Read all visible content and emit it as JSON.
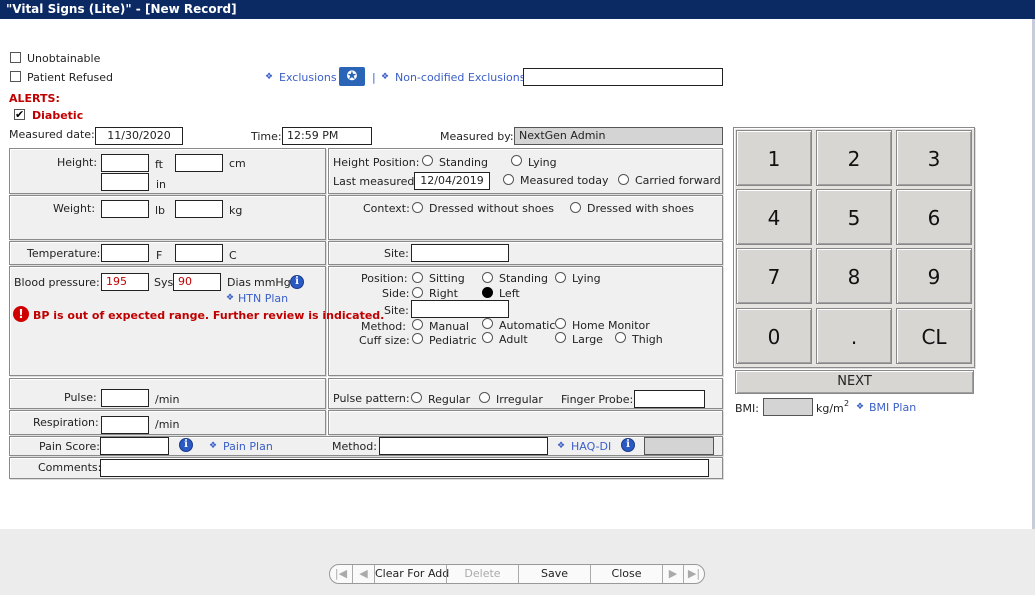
{
  "window": {
    "title": "\"Vital Signs (Lite)\" - [New Record]"
  },
  "checks": {
    "unobtainable": "Unobtainable",
    "patient_refused": "Patient Refused"
  },
  "exclusions": {
    "label": "Exclusions",
    "separator": "|",
    "noncodified_label": "Non-codified Exclusions",
    "noncodified_value": ""
  },
  "alerts": {
    "heading": "ALERTS:",
    "diabetic": "Diabetic",
    "check_mark": "✔"
  },
  "measured": {
    "date_label": "Measured date:",
    "date_value": "11/30/2020",
    "time_label": "Time:",
    "time_value": "12:59 PM",
    "by_label": "Measured by:",
    "by_value": "NextGen Admin"
  },
  "height": {
    "label": "Height:",
    "ft_unit": "ft",
    "cm_unit": "cm",
    "in_unit": "in",
    "position_label": "Height Position:",
    "standing": "Standing",
    "lying": "Lying",
    "last_measured_label": "Last measured:",
    "last_measured_value": "12/04/2019",
    "measured_today": "Measured today",
    "carried_forward": "Carried forward"
  },
  "weight": {
    "label": "Weight:",
    "lb_unit": "lb",
    "kg_unit": "kg",
    "context_label": "Context:",
    "without_shoes": "Dressed without shoes",
    "with_shoes": "Dressed with shoes"
  },
  "temperature": {
    "label": "Temperature:",
    "f_unit": "F",
    "c_unit": "C",
    "site_label": "Site:"
  },
  "bp": {
    "label": "Blood pressure:",
    "sys_value": "195",
    "sys_unit": "Sys",
    "dias_value": "90",
    "dias_unit": "Dias",
    "mmhg": "mmHg",
    "htn_plan": "HTN Plan",
    "warning": "BP is out of expected range. Further review is indicated.",
    "alert_glyph": "!",
    "info_glyph": "i",
    "position_label": "Position:",
    "sitting": "Sitting",
    "standing": "Standing",
    "lying": "Lying",
    "side_label": "Side:",
    "right": "Right",
    "left": "Left",
    "site_label": "Site:",
    "method_label": "Method:",
    "manual": "Manual",
    "automatic": "Automatic",
    "home_monitor": "Home Monitor",
    "cuff_label": "Cuff size:",
    "pediatric": "Pediatric",
    "adult": "Adult",
    "large": "Large",
    "thigh": "Thigh"
  },
  "pulse": {
    "label": "Pulse:",
    "unit": "/min",
    "pattern_label": "Pulse pattern:",
    "regular": "Regular",
    "irregular": "Irregular",
    "finger_probe_label": "Finger Probe:"
  },
  "respiration": {
    "label": "Respiration:",
    "unit": "/min"
  },
  "pain": {
    "label": "Pain Score:",
    "plan": "Pain Plan",
    "method_label": "Method:",
    "haq_di": "HAQ-DI"
  },
  "comments": {
    "label": "Comments:"
  },
  "keypad": {
    "keys": [
      "1",
      "2",
      "3",
      "4",
      "5",
      "6",
      "7",
      "8",
      "9",
      "0",
      ".",
      "CL"
    ],
    "next": "NEXT"
  },
  "bmi": {
    "label": "BMI:",
    "unit": "kg/m",
    "sup": "2",
    "plan": "BMI Plan"
  },
  "footer": {
    "first": "|◀",
    "prev": "◀",
    "clear_for_add": "Clear For Add",
    "delete": "Delete",
    "save": "Save",
    "close": "Close",
    "next": "▶",
    "last": "▶|"
  },
  "icons": {
    "exclusion": "exclusion-icon",
    "diamond": "diamond-icon",
    "info": "info-icon",
    "alert": "alert-icon",
    "accent": "#0b2a63",
    "link_color": "#3a5fc7",
    "alert_color": "#c00000"
  }
}
